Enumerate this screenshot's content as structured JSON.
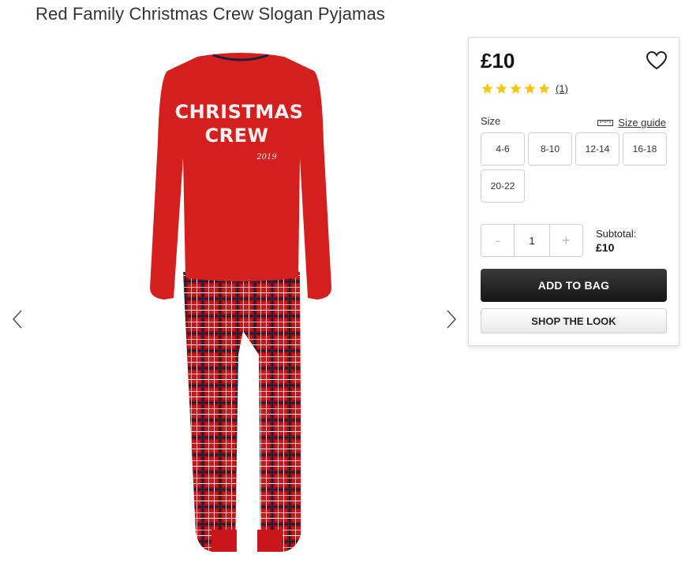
{
  "product": {
    "title": "Red Family Christmas Crew Slogan Pyjamas",
    "image_print_title_line1": "CHRISTMAS",
    "image_print_title_line2": "CREW",
    "image_print_year": "2019"
  },
  "gallery": {
    "prev_icon": "chevron-left-icon",
    "next_icon": "chevron-right-icon"
  },
  "buy_panel": {
    "price": "£10",
    "wishlist_icon": "heart-outline-icon",
    "rating": {
      "stars": 5,
      "max": 5,
      "review_count": "(1)"
    },
    "size_label": "Size",
    "size_guide_label": "Size guide",
    "size_guide_icon": "ruler-icon",
    "sizes": [
      "4-6",
      "8-10",
      "12-14",
      "16-18",
      "20-22"
    ],
    "quantity": {
      "decrement": "-",
      "value": "1",
      "increment": "+"
    },
    "subtotal_label": "Subtotal:",
    "subtotal_value": "£10",
    "add_to_bag": "ADD TO BAG",
    "shop_the_look": "SHOP THE LOOK"
  },
  "colors": {
    "star": "#f5c518",
    "pyjama_red": "#d41f1f",
    "primary_button": "#222222"
  }
}
